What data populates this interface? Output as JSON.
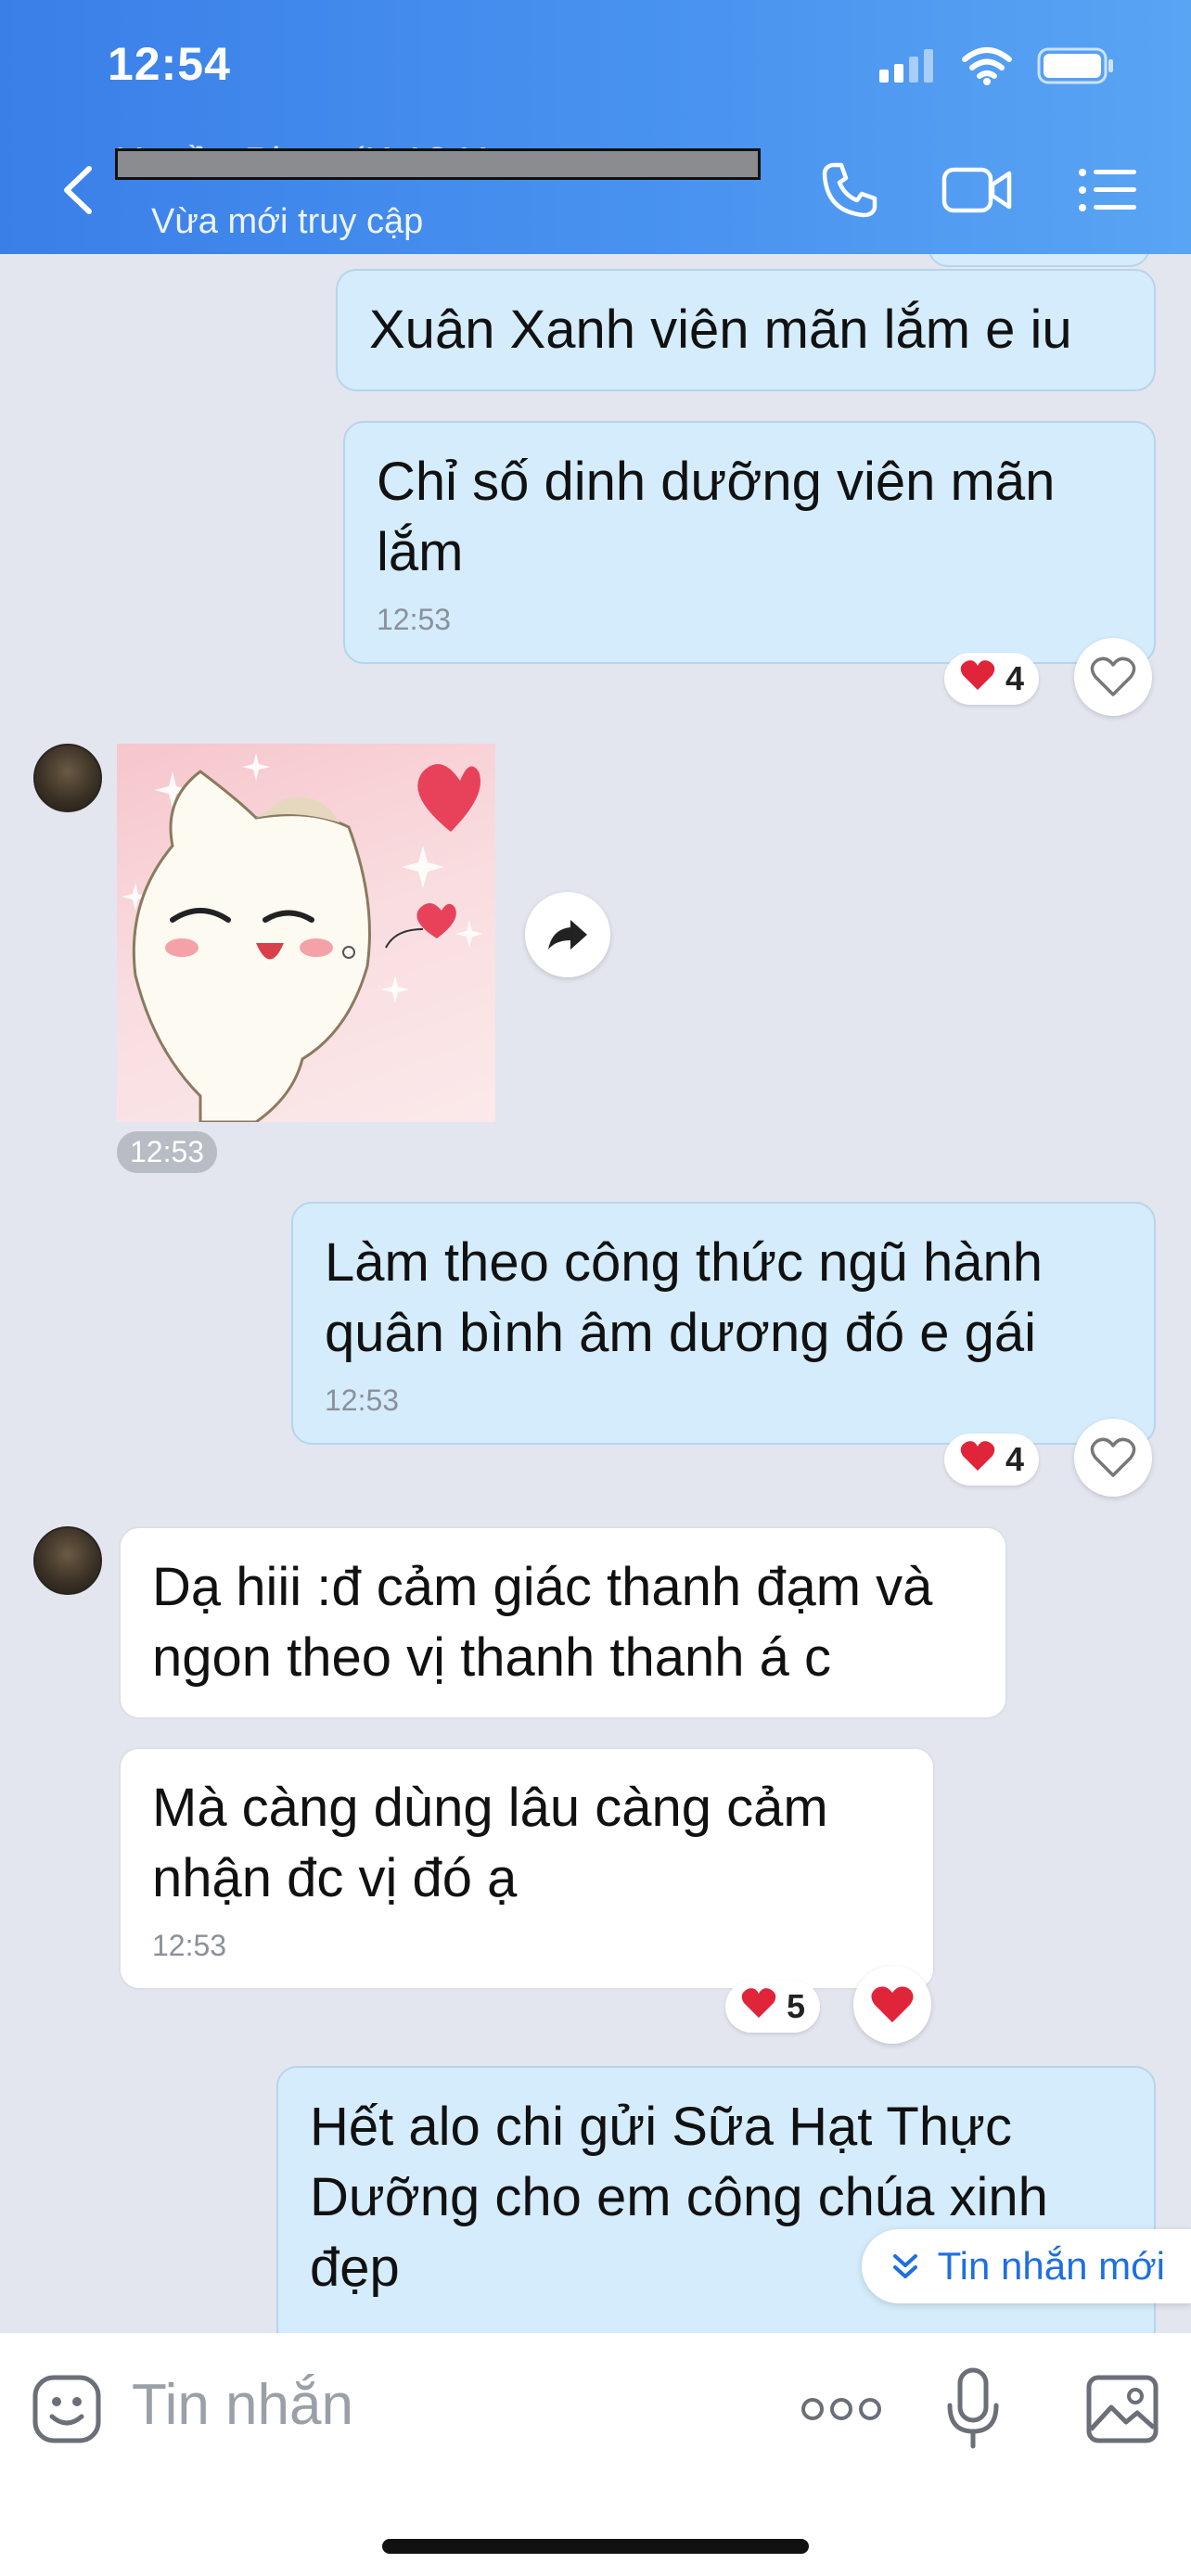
{
  "status_bar": {
    "time": "12:54"
  },
  "header": {
    "contact_name": "Huyền Phan (K 13 X...",
    "contact_status": "Vừa mới truy cập"
  },
  "messages": [
    {
      "id": "m1",
      "direction": "out",
      "text": "Xuân Xanh viên mãn lắm e iu"
    },
    {
      "id": "m2",
      "direction": "out",
      "text": "Chỉ số dinh dưỡng viên mãn lắm",
      "time": "12:53",
      "reaction_count": "4"
    },
    {
      "id": "m3",
      "direction": "in",
      "type": "sticker",
      "time": "12:53"
    },
    {
      "id": "m4",
      "direction": "out",
      "text": "Làm theo công thức ngũ hành quân bình âm dương đó e gái",
      "time": "12:53",
      "reaction_count": "4"
    },
    {
      "id": "m5",
      "direction": "in",
      "text": "Dạ hiii :đ cảm giác thanh đạm và ngon theo vị thanh thanh á c"
    },
    {
      "id": "m6",
      "direction": "in",
      "text": "Mà càng dùng lâu càng cảm nhận đc vị đó ạ",
      "time": "12:53",
      "reaction_count": "5"
    },
    {
      "id": "m7",
      "direction": "out",
      "text": "Hết alo chi gửi Sữa Hạt Thực Dưỡng cho em công chúa xinh đẹp"
    }
  ],
  "new_message_banner": "Tin nhắn mới",
  "input": {
    "placeholder": "Tin nhắn"
  },
  "colors": {
    "header": "#3a7fe8",
    "outgoing_bubble": "#d4ecfb",
    "incoming_bubble": "#ffffff",
    "heart": "#e0243a",
    "link": "#1f6fe0"
  }
}
